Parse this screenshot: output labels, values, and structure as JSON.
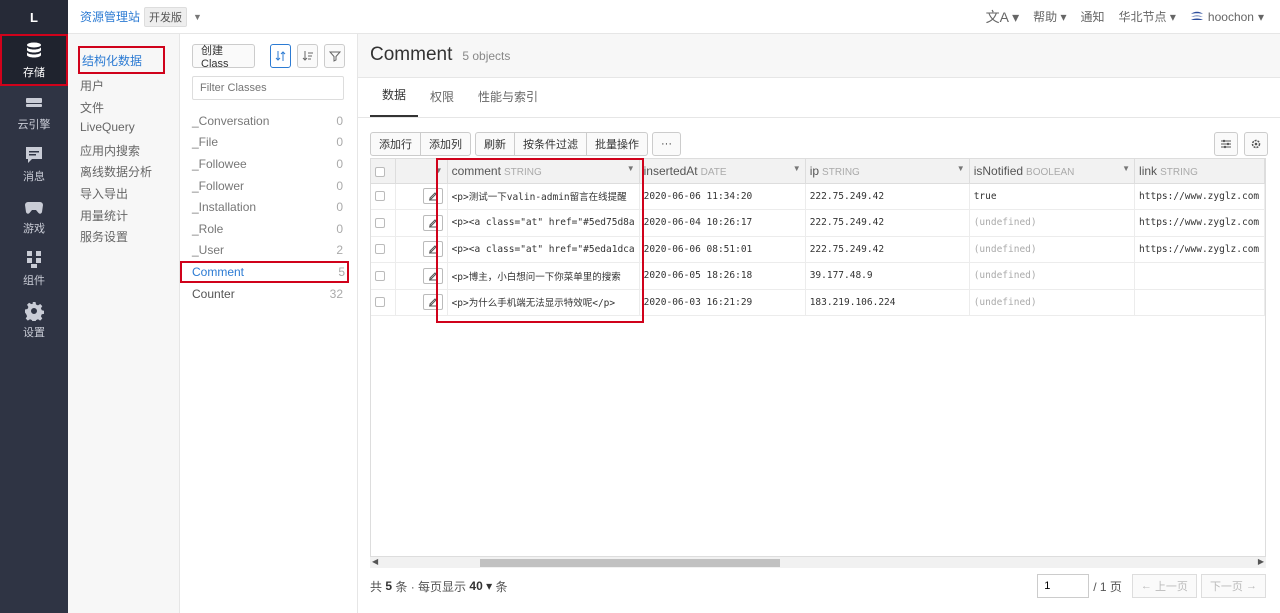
{
  "rail": {
    "logo": "L",
    "items": [
      {
        "label": "存储",
        "icon": "database-icon",
        "active": true
      },
      {
        "label": "云引擎",
        "icon": "server-icon"
      },
      {
        "label": "消息",
        "icon": "message-icon"
      },
      {
        "label": "游戏",
        "icon": "gamepad-icon"
      },
      {
        "label": "组件",
        "icon": "components-icon"
      },
      {
        "label": "设置",
        "icon": "gear-icon"
      }
    ]
  },
  "topbar": {
    "app_name": "资源管理站",
    "edition": "开发版",
    "translate_icon": "translate-icon",
    "help": "帮助",
    "notify": "通知",
    "region": "华北节点",
    "user": "hoochon"
  },
  "nav": {
    "items": [
      "结构化数据",
      "用户",
      "文件",
      "LiveQuery",
      "应用内搜索",
      "离线数据分析",
      "导入导出",
      "用量统计",
      "服务设置"
    ]
  },
  "classes": {
    "create_label": "创建 Class",
    "filter_placeholder": "Filter Classes",
    "list": [
      {
        "name": "_Conversation",
        "count": "0"
      },
      {
        "name": "_File",
        "count": "0"
      },
      {
        "name": "_Followee",
        "count": "0"
      },
      {
        "name": "_Follower",
        "count": "0"
      },
      {
        "name": "_Installation",
        "count": "0"
      },
      {
        "name": "_Role",
        "count": "0"
      },
      {
        "name": "_User",
        "count": "2"
      },
      {
        "name": "Comment",
        "count": "5"
      },
      {
        "name": "Counter",
        "count": "32"
      }
    ]
  },
  "main": {
    "title": "Comment",
    "subtitle": "5 objects",
    "tabs": [
      "数据",
      "权限",
      "性能与索引"
    ],
    "actions": {
      "add_row": "添加行",
      "add_col": "添加列",
      "refresh": "刷新",
      "filter": "按条件过滤",
      "batch": "批量操作",
      "more": "···"
    },
    "columns": [
      {
        "name": "comment",
        "type": "STRING"
      },
      {
        "name": "insertedAt",
        "type": "DATE"
      },
      {
        "name": "ip",
        "type": "STRING"
      },
      {
        "name": "isNotified",
        "type": "BOOLEAN"
      },
      {
        "name": "link",
        "type": "STRING"
      }
    ],
    "rows": [
      {
        "comment": "<p>测试一下valin-admin留言在线提醒",
        "insertedAt": "2020-06-06 11:34:20",
        "ip": "222.75.249.42",
        "isNotified": "true",
        "link": "https://www.zyglz.com"
      },
      {
        "comment": "<p><a class=\"at\" href=\"#5ed75d8a",
        "insertedAt": "2020-06-04 10:26:17",
        "ip": "222.75.249.42",
        "isNotified": "(undefined)",
        "link": "https://www.zyglz.com"
      },
      {
        "comment": "<p><a class=\"at\" href=\"#5eda1dca",
        "insertedAt": "2020-06-06 08:51:01",
        "ip": "222.75.249.42",
        "isNotified": "(undefined)",
        "link": "https://www.zyglz.com"
      },
      {
        "comment": "<p>博主，小白想问一下你菜单里的搜索",
        "insertedAt": "2020-06-05 18:26:18",
        "ip": "39.177.48.9",
        "isNotified": "(undefined)",
        "link": ""
      },
      {
        "comment": "<p>为什么手机端无法显示特效呢</p>",
        "insertedAt": "2020-06-03 16:21:29",
        "ip": "183.219.106.224",
        "isNotified": "(undefined)",
        "link": ""
      }
    ],
    "pager": {
      "total_prefix": "共",
      "total": "5",
      "total_suffix": "条 · 每页显示",
      "per_page": "40",
      "per_page_suffix": "条",
      "page_value": "1",
      "page_total": "/ 1 页",
      "prev": "上一页",
      "next": "下一页"
    }
  }
}
